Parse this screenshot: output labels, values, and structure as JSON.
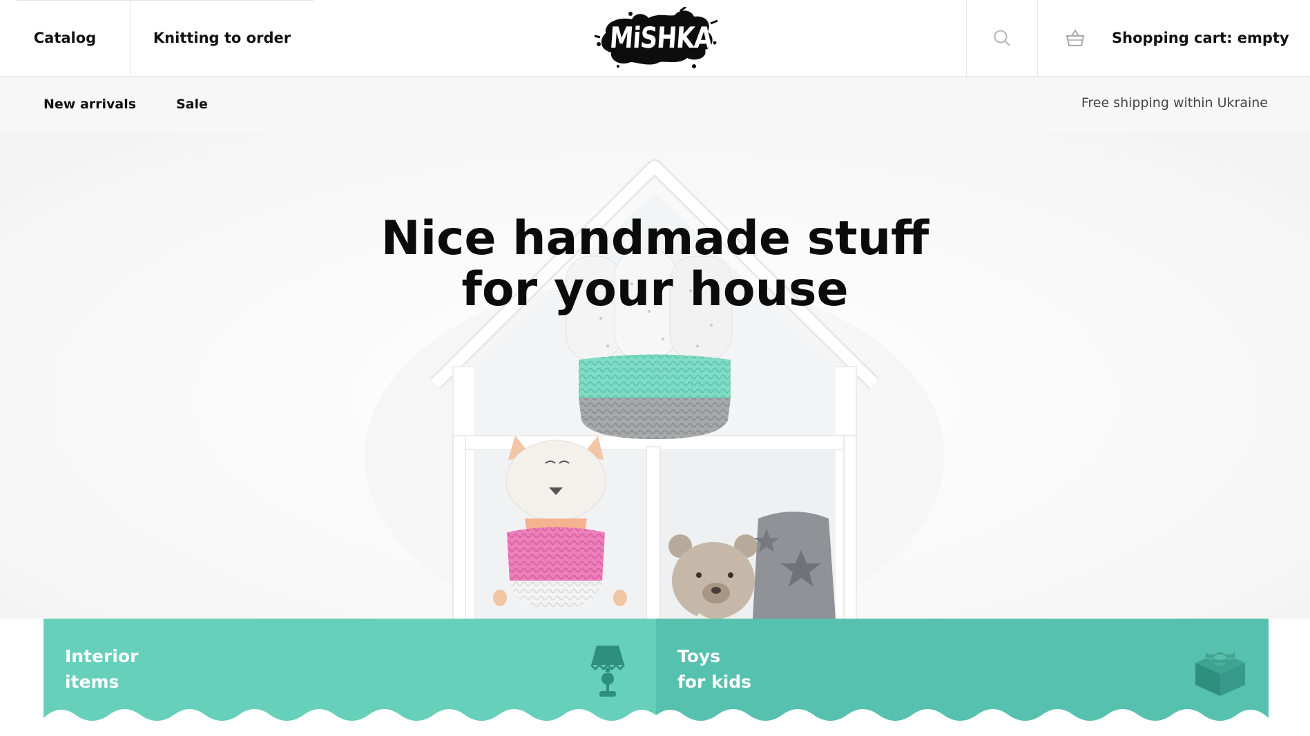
{
  "header": {
    "nav": [
      {
        "label": "Catalog"
      },
      {
        "label": "Knitting to order"
      }
    ],
    "logo_text": "MiSHKA",
    "search_icon": "search-icon",
    "cart_icon": "basket-icon",
    "cart_label": "Shopping cart: empty"
  },
  "subnav": {
    "links": [
      {
        "label": "New arrivals"
      },
      {
        "label": "Sale"
      }
    ],
    "shipping_note": "Free shipping within Ukraine"
  },
  "hero": {
    "title_line1": "Nice handmade stuff",
    "title_line2": "for your house"
  },
  "categories": [
    {
      "line1": "Interior",
      "line2": "items",
      "icon": "lamp-icon",
      "color": "#66d0bb"
    },
    {
      "line1": "Toys",
      "line2": "for kids",
      "icon": "building-block-icon",
      "color": "#56c1ae"
    }
  ]
}
